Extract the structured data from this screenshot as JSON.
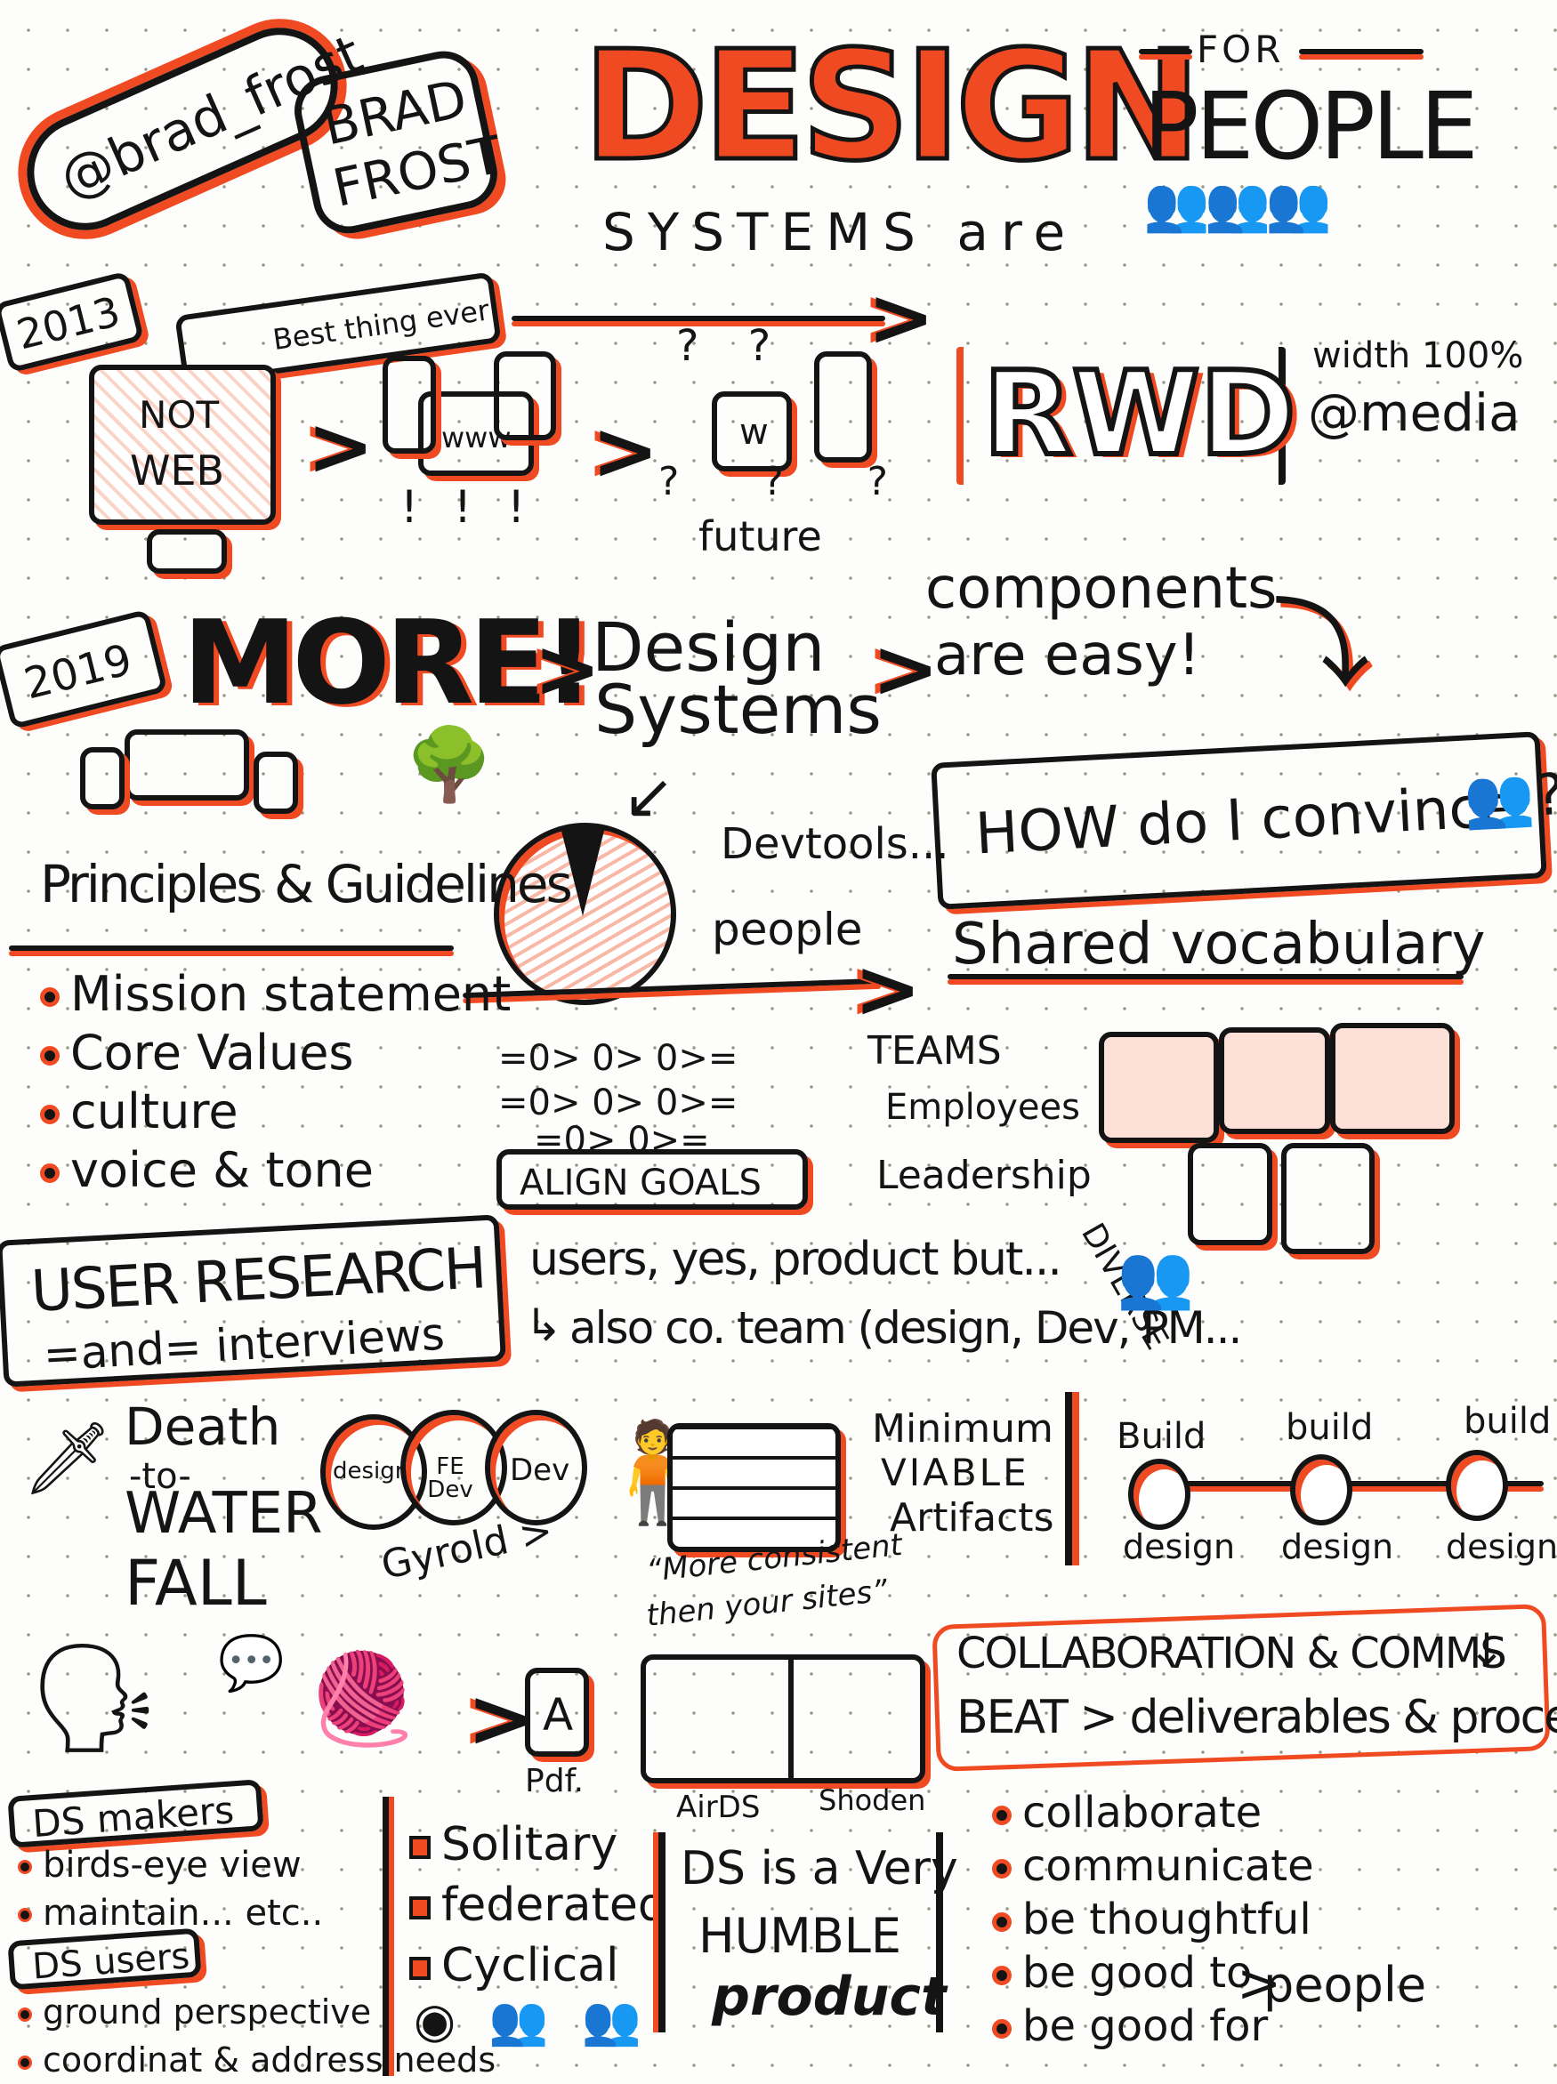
{
  "header": {
    "handle": "@brad_frost",
    "name_line1": "BRAD",
    "name_line2": "FROST",
    "title_big": "DESIGN",
    "title_for": "FOR",
    "title_people": "PEOPLE",
    "title_systems": "SYSTEMS are"
  },
  "era_2013": {
    "year": "2013",
    "monitor_line1": "NOT",
    "monitor_line2": "WEB",
    "banner": "Best thing ever",
    "www": "www",
    "future_window": "w",
    "future": "future",
    "rwd": "RWD",
    "width": "width 100%",
    "media": "@media"
  },
  "era_2019": {
    "year": "2019",
    "more": "MORE!",
    "design_systems_line1": "Design",
    "design_systems_line2": "Systems",
    "components_line1": "components",
    "components_line2": "are easy!",
    "convince": "HOW do I convince",
    "devtools": "Devtools...",
    "people": "people"
  },
  "principles": {
    "title": "Principles & Guidelines",
    "items": [
      "Mission statement",
      "Core Values",
      "culture",
      "voice & tone"
    ],
    "shared_vocabulary": "Shared vocabulary"
  },
  "align": {
    "rows": [
      "=0> 0> 0>=",
      "=0> 0> 0>=",
      "=0> 0>="
    ],
    "goals": "ALIGN GOALS",
    "groups": [
      "TEAMS",
      "Employees",
      "Leadership"
    ],
    "diverse": "DIVERSE"
  },
  "user_research": {
    "title": "USER RESEARCH",
    "subtitle": "=and= interviews",
    "note1": "users, yes, product but...",
    "note2": "also co. team (design, Dev, PM..."
  },
  "process": {
    "death_line1": "Death",
    "death_line2": "-to-",
    "death_line3": "WATER",
    "death_line4": "FALL",
    "venn": [
      "design",
      "FE Dev",
      "Dev"
    ],
    "gyrold": "Gyrold >",
    "quote_line1": "“More consistent",
    "quote_line2": "then your sites”",
    "mva_line1": "Minimum",
    "mva_line2": "VIABLE",
    "mva_line3": "Artifacts",
    "build_labels": [
      "Build",
      "build",
      "build"
    ],
    "design_labels": [
      "design",
      "design",
      "design"
    ]
  },
  "deliverables": {
    "pdf_letter": "A",
    "pdf": "Pdf.",
    "airds": "AirDS",
    "shoden": "Shoden",
    "collab": "COLLABORATION & COMMS",
    "beat": "BEAT > deliverables & process"
  },
  "roles": {
    "makers_title": "DS makers",
    "makers_items": [
      "birds-eye view",
      "maintain... etc.."
    ],
    "users_title": "DS users",
    "users_items": [
      "ground perspective",
      "coordinat & address needs"
    ]
  },
  "models": {
    "items": [
      "Solitary",
      "federated",
      "Cyclical"
    ]
  },
  "humble": {
    "line1": "DS is a Very",
    "line2": "HUMBLE",
    "line3": "product"
  },
  "actions": {
    "items": [
      "collaborate",
      "communicate",
      "be thoughtful",
      "be good to",
      "be good for"
    ],
    "people": "people"
  },
  "colors": {
    "ink": "#141414",
    "accent": "#f04a23",
    "paper": "#fdfdfb"
  }
}
